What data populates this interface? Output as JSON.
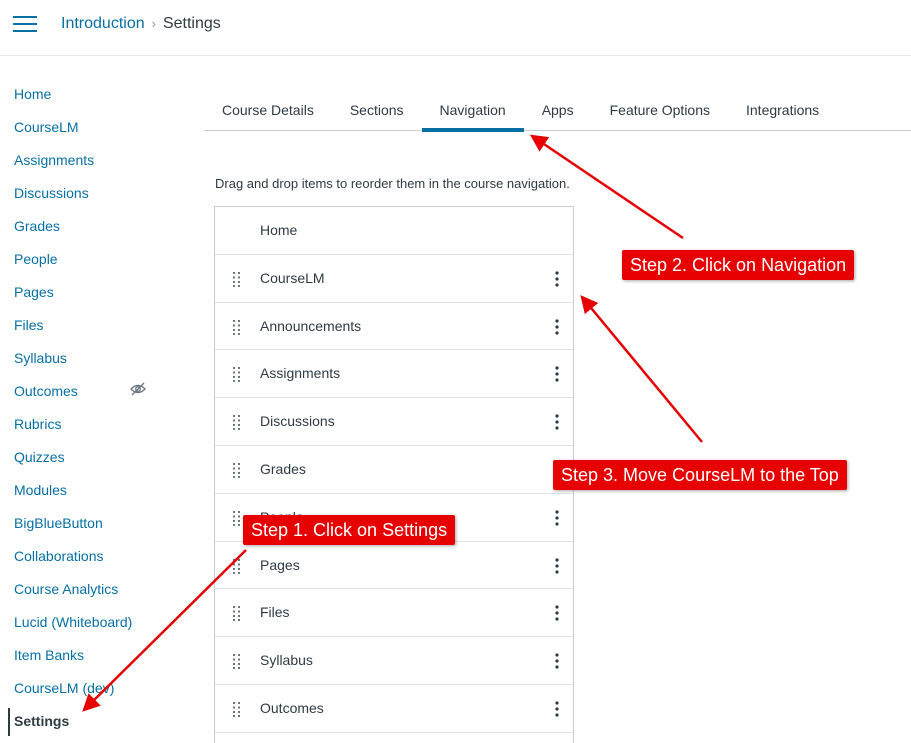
{
  "header": {
    "breadcrumb": {
      "course": "Introduction",
      "separator": "›",
      "current": "Settings"
    },
    "menu_icon": "hamburger-icon"
  },
  "sidebar": {
    "items": [
      {
        "label": "Home"
      },
      {
        "label": "CourseLM"
      },
      {
        "label": "Assignments"
      },
      {
        "label": "Discussions"
      },
      {
        "label": "Grades"
      },
      {
        "label": "People"
      },
      {
        "label": "Pages"
      },
      {
        "label": "Files"
      },
      {
        "label": "Syllabus"
      },
      {
        "label": "Outcomes",
        "icon": "eye-slash-icon"
      },
      {
        "label": "Rubrics"
      },
      {
        "label": "Quizzes"
      },
      {
        "label": "Modules"
      },
      {
        "label": "BigBlueButton"
      },
      {
        "label": "Collaborations"
      },
      {
        "label": "Course Analytics"
      },
      {
        "label": "Lucid (Whiteboard)"
      },
      {
        "label": "Item Banks"
      },
      {
        "label": "CourseLM (dev)"
      },
      {
        "label": "Settings",
        "active": true
      }
    ]
  },
  "tabs": [
    {
      "label": "Course Details"
    },
    {
      "label": "Sections"
    },
    {
      "label": "Navigation",
      "active": true
    },
    {
      "label": "Apps"
    },
    {
      "label": "Feature Options"
    },
    {
      "label": "Integrations"
    }
  ],
  "navigation": {
    "instructions": "Drag and drop items to reorder them in the course navigation.",
    "items": [
      {
        "label": "Home"
      },
      {
        "label": "CourseLM"
      },
      {
        "label": "Announcements"
      },
      {
        "label": "Assignments"
      },
      {
        "label": "Discussions"
      },
      {
        "label": "Grades"
      },
      {
        "label": "People"
      },
      {
        "label": "Pages"
      },
      {
        "label": "Files"
      },
      {
        "label": "Syllabus"
      },
      {
        "label": "Outcomes"
      }
    ]
  },
  "annotations": {
    "step1": "Step 1. Click on Settings",
    "step2": "Step 2. Click on Navigation",
    "step3": "Step 3. Move CourseLM to the Top",
    "color": "#e60000"
  },
  "colors": {
    "link": "#0770a3",
    "text": "#2d3b45",
    "accent": "#0770a3"
  }
}
